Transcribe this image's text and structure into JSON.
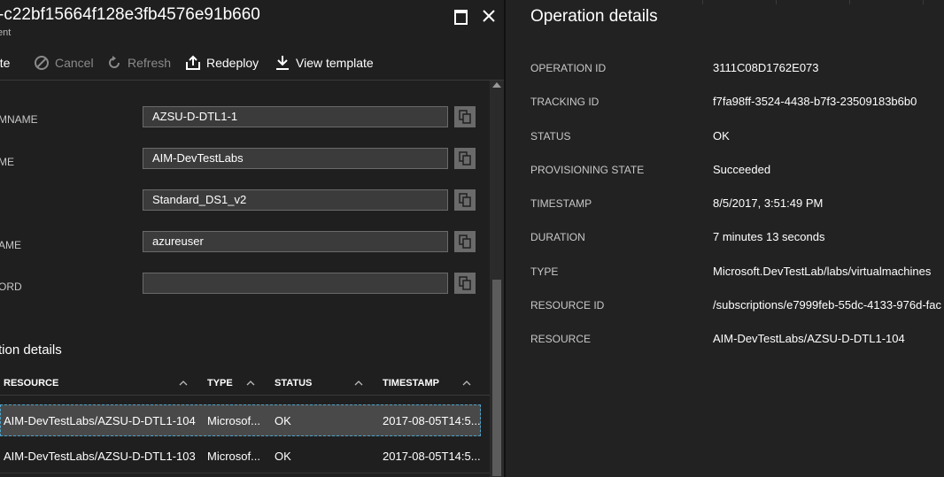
{
  "left_blade": {
    "title": "-c22bf15664f128e3fb4576e91b660",
    "subtitle": "ent",
    "toolbar": {
      "delete_label": "ete",
      "cancel_label": "Cancel",
      "refresh_label": "Refresh",
      "redeploy_label": "Redeploy",
      "view_template_label": "View template"
    },
    "fields": [
      {
        "label": "MNAME",
        "value": "AZSU-D-DTL1-1"
      },
      {
        "label": "ME",
        "value": "AIM-DevTestLabs"
      },
      {
        "label": "",
        "value": "Standard_DS1_v2"
      },
      {
        "label": "AME",
        "value": "azureuser"
      },
      {
        "label": "ORD",
        "value": ""
      }
    ],
    "section_title": "tion details",
    "table": {
      "headers": [
        "RESOURCE",
        "TYPE",
        "STATUS",
        "TIMESTAMP"
      ],
      "rows": [
        [
          "AIM-DevTestLabs/AZSU-D-DTL1-104",
          "Microsof...",
          "OK",
          "2017-08-05T14:5..."
        ],
        [
          "AIM-DevTestLabs/AZSU-D-DTL1-103",
          "Microsof...",
          "OK",
          "2017-08-05T14:5..."
        ]
      ]
    }
  },
  "right_blade": {
    "title": "Operation details",
    "properties": [
      {
        "label": "OPERATION ID",
        "value": "3111C08D1762E073"
      },
      {
        "label": "TRACKING ID",
        "value": "f7fa98ff-3524-4438-b7f3-23509183b6b0"
      },
      {
        "label": "STATUS",
        "value": "OK"
      },
      {
        "label": "PROVISIONING STATE",
        "value": "Succeeded"
      },
      {
        "label": "TIMESTAMP",
        "value": "8/5/2017, 3:51:49 PM"
      },
      {
        "label": "DURATION",
        "value": "7 minutes 13 seconds"
      },
      {
        "label": "TYPE",
        "value": "Microsoft.DevTestLab/labs/virtualmachines"
      },
      {
        "label": "RESOURCE ID",
        "value": "/subscriptions/e7999feb-55dc-4133-976d-fac"
      },
      {
        "label": "RESOURCE",
        "value": "AIM-DevTestLabs/AZSU-D-DTL1-104"
      }
    ]
  },
  "colors": {
    "background": "#222222",
    "left_blade_bg": "#1f1f1f",
    "input_bg": "#3b3b3b",
    "selected_row_bg": "#494949",
    "selection_outline": "#4ea3c9",
    "disabled_text": "#8a8a8a"
  }
}
